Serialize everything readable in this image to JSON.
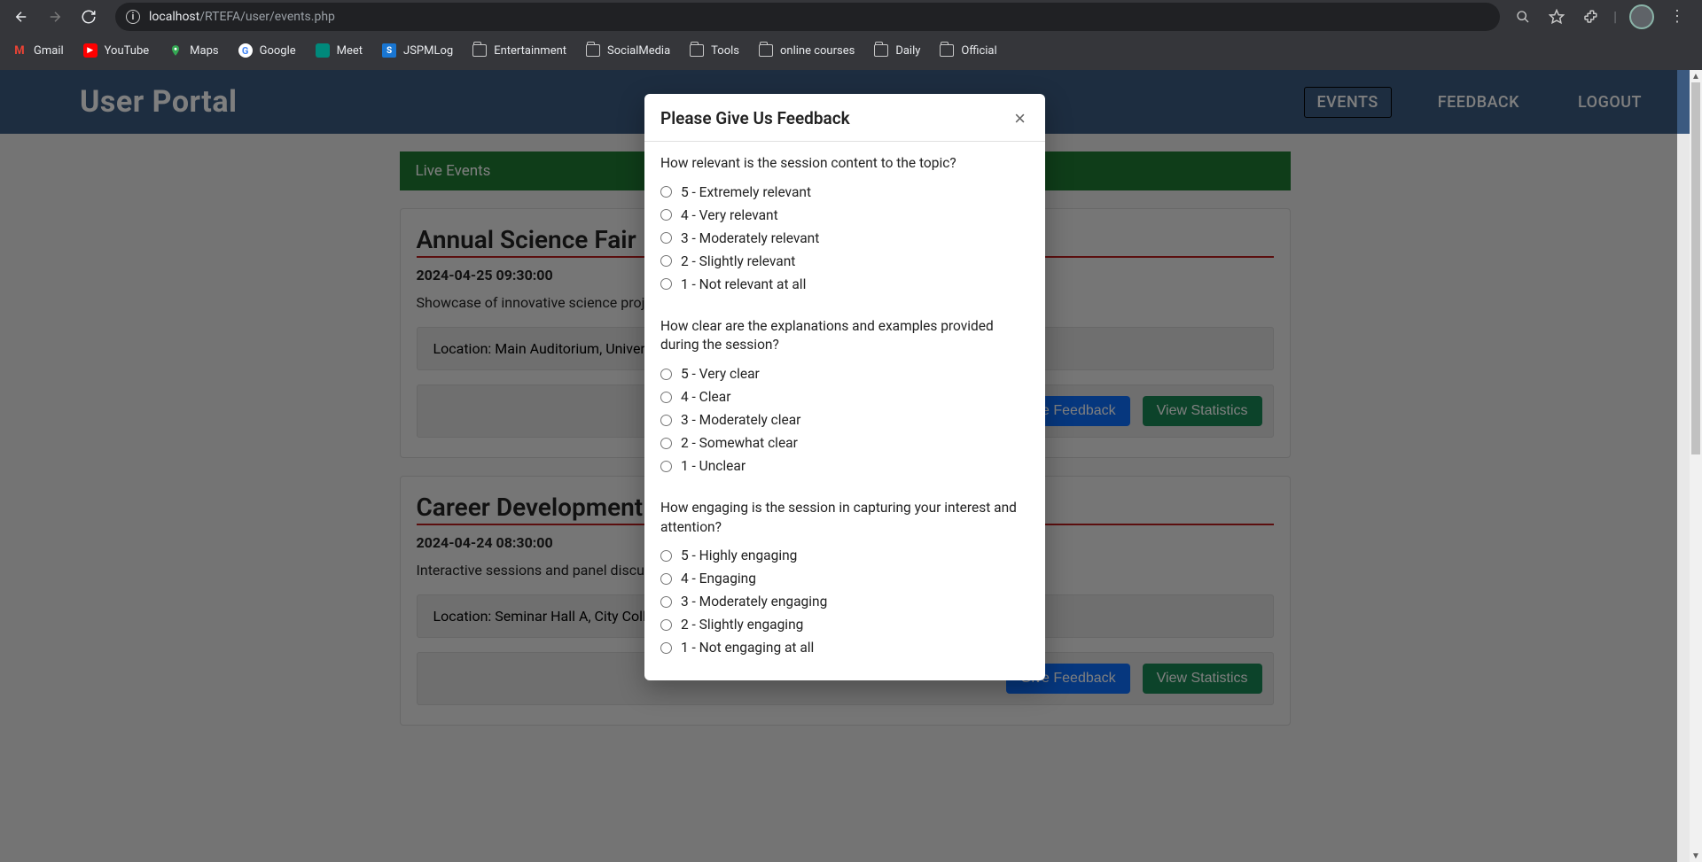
{
  "browser": {
    "url_host": "localhost",
    "url_path": "/RTEFA/user/events.php",
    "bookmarks": [
      {
        "label": "Gmail",
        "icon": "gmail-icon"
      },
      {
        "label": "YouTube",
        "icon": "youtube-icon"
      },
      {
        "label": "Maps",
        "icon": "maps-icon"
      },
      {
        "label": "Google",
        "icon": "google-icon"
      },
      {
        "label": "Meet",
        "icon": "meet-icon"
      },
      {
        "label": "JSPMLog",
        "icon": "jspmlog-icon"
      },
      {
        "label": "Entertainment",
        "icon": "folder-icon"
      },
      {
        "label": "SocialMedia",
        "icon": "folder-icon"
      },
      {
        "label": "Tools",
        "icon": "folder-icon"
      },
      {
        "label": "online courses",
        "icon": "folder-icon"
      },
      {
        "label": "Daily",
        "icon": "folder-icon"
      },
      {
        "label": "Official",
        "icon": "folder-icon"
      }
    ]
  },
  "header": {
    "title": "User Portal",
    "nav": [
      {
        "label": "EVENTS",
        "active": true
      },
      {
        "label": "FEEDBACK",
        "active": false
      },
      {
        "label": "LOGOUT",
        "active": false
      }
    ]
  },
  "section_title": "Live Events",
  "events": [
    {
      "title": "Annual Science Fair",
      "datetime": "2024-04-25 09:30:00",
      "description": "Showcase of innovative science projects",
      "location": "Location: Main Auditorium, University",
      "feedback_label": "Give Feedback",
      "stats_label": "View Statistics"
    },
    {
      "title": "Career Development",
      "datetime": "2024-04-24 08:30:00",
      "description": "Interactive sessions and panel discussions",
      "location": "Location: Seminar Hall A, City College",
      "feedback_label": "Give Feedback",
      "stats_label": "View Statistics"
    }
  ],
  "modal": {
    "title": "Please Give Us Feedback",
    "questions": [
      {
        "text": "How relevant is the session content to the topic?",
        "options": [
          "5 - Extremely relevant",
          "4 - Very relevant",
          "3 - Moderately relevant",
          "2 - Slightly relevant",
          "1 - Not relevant at all"
        ]
      },
      {
        "text": "How clear are the explanations and examples provided during the session?",
        "options": [
          "5 - Very clear",
          "4 - Clear",
          "3 - Moderately clear",
          "2 - Somewhat clear",
          "1 - Unclear"
        ]
      },
      {
        "text": "How engaging is the session in capturing your interest and attention?",
        "options": [
          "5 - Highly engaging",
          "4 - Engaging",
          "3 - Moderately engaging",
          "2 - Slightly engaging",
          "1 - Not engaging at all"
        ]
      }
    ]
  }
}
